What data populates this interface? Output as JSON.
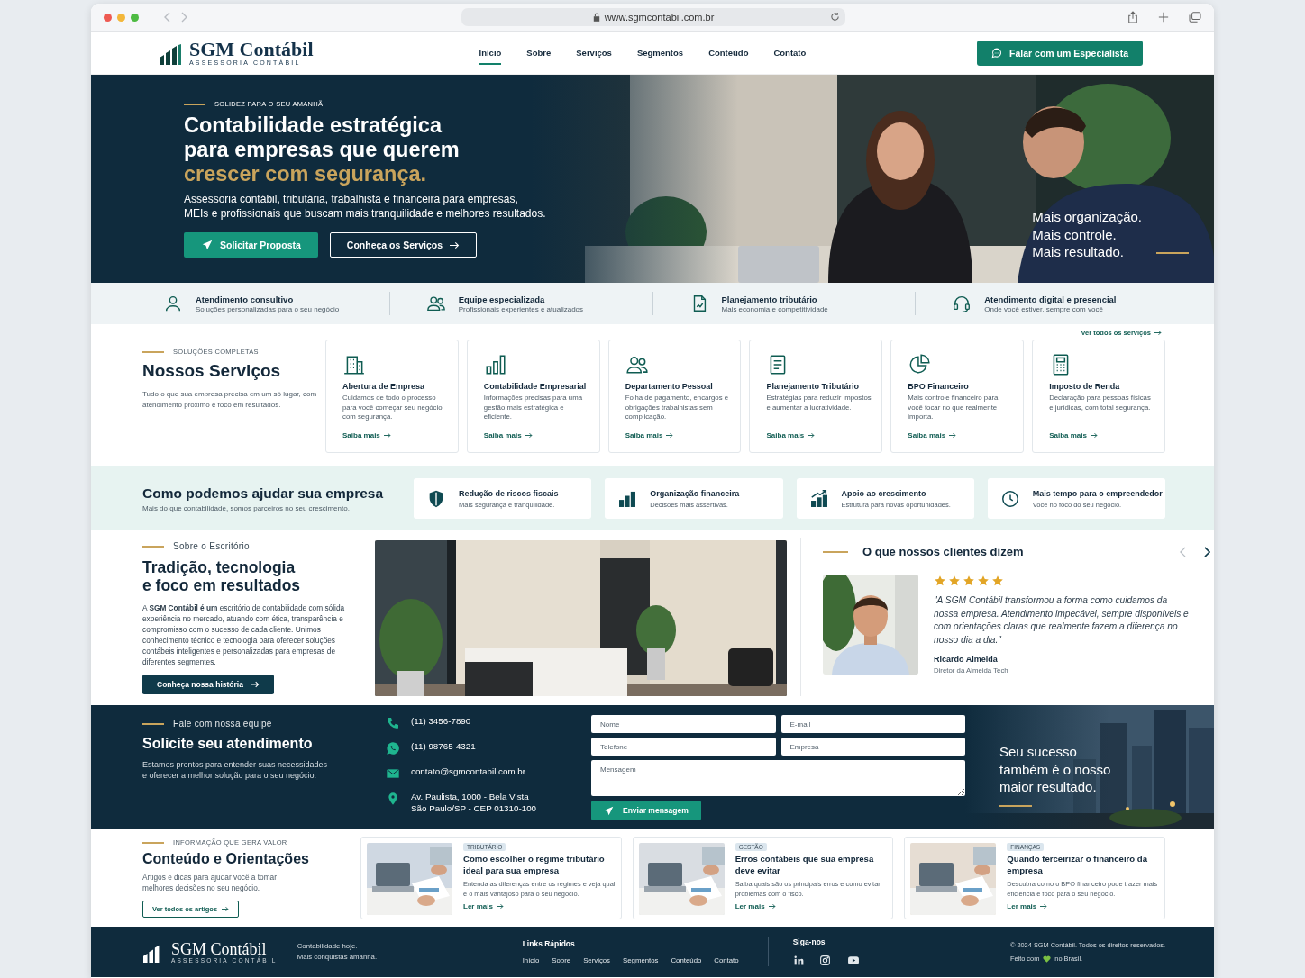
{
  "browser": {
    "url": "www.sgmcontabil.com.br"
  },
  "header": {
    "logo": {
      "name": "SGM Contábil",
      "tagline": "ASSESSORIA CONTÁBIL"
    },
    "nav": [
      {
        "label": "Início",
        "selected": true
      },
      {
        "label": "Sobre",
        "selected": false
      },
      {
        "label": "Serviços",
        "selected": false
      },
      {
        "label": "Segmentos",
        "selected": false
      },
      {
        "label": "Conteúdo",
        "selected": false
      },
      {
        "label": "Contato",
        "selected": false
      }
    ],
    "cta": "Falar com um Especialista"
  },
  "hero": {
    "eyebrow": "SOLIDEZ PARA O SEU AMANHÃ",
    "title": "Contabilidade estratégica\npara empresas que querem",
    "title_accent": "crescer com segurança.",
    "subtitle": "Assessoria contábil, tributária, trabalhista e financeira para empresas,\nMEIs e profissionais que buscam mais tranquilidade e melhores resultados.",
    "buttons": [
      {
        "label": "Solicitar Proposta",
        "kind": "primary"
      },
      {
        "label": "Conheça os Serviços",
        "kind": "outline"
      }
    ],
    "tagline": "Mais organização.\nMais controle.\nMais resultado."
  },
  "highlights": [
    {
      "kind": "user",
      "title": "Atendimento consultivo",
      "text": "Soluções personalizadas para o seu negócio"
    },
    {
      "kind": "users",
      "title": "Equipe especializada",
      "text": "Profissionais experientes e atualizados"
    },
    {
      "kind": "doc",
      "title": "Planejamento tributário",
      "text": "Mais economia e competitividade"
    },
    {
      "kind": "headset",
      "title": "Atendimento digital e presencial",
      "text": "Onde você estiver, sempre com você"
    }
  ],
  "services": {
    "eyebrow": "SOLUÇÕES COMPLETAS",
    "title": "Nossos Serviços",
    "text": "Tudo o que sua empresa precisa em um só lugar, com atendimento próximo e foco em resultados.",
    "see_all": "Ver todos os serviços",
    "items": [
      {
        "kind": "building",
        "title": "Abertura de Empresa",
        "text": "Cuidamos de todo o processo para você começar seu negócio com segurança.",
        "link": "Saiba mais"
      },
      {
        "kind": "bars",
        "title": "Contabilidade Empresarial",
        "text": "Informações precisas para uma gestão mais estratégica e eficiente.",
        "link": "Saiba mais"
      },
      {
        "kind": "users",
        "title": "Departamento Pessoal",
        "text": "Folha de pagamento, encargos e obrigações trabalhistas sem complicação.",
        "link": "Saiba mais"
      },
      {
        "kind": "clipboard",
        "title": "Planejamento Tributário",
        "text": "Estratégias para reduzir impostos e aumentar a lucratividade.",
        "link": "Saiba mais"
      },
      {
        "kind": "pie",
        "title": "BPO Financeiro",
        "text": "Mais controle financeiro para você focar no que realmente importa.",
        "link": "Saiba mais"
      },
      {
        "kind": "calculator",
        "title": "Imposto de Renda",
        "text": "Declaração para pessoas físicas e jurídicas, com total segurança.",
        "link": "Saiba mais"
      }
    ]
  },
  "help": {
    "title": "Como podemos ajudar sua empresa",
    "subtitle": "Mais do que contabilidade, somos parceiros no seu crescimento.",
    "items": [
      {
        "kind": "shield",
        "title": "Redução de riscos fiscais",
        "text": "Mais segurança e tranquilidade."
      },
      {
        "kind": "barsfill",
        "title": "Organização financeira",
        "text": "Decisões mais assertivas."
      },
      {
        "kind": "growth",
        "title": "Apoio ao crescimento",
        "text": "Estrutura para novas oportunidades."
      },
      {
        "kind": "clock",
        "title": "Mais tempo para o empreendedor",
        "text": "Você no foco do seu negócio."
      }
    ]
  },
  "about": {
    "eyebrow": "Sobre o Escritório",
    "title": "Tradição, tecnologia\ne foco em resultados",
    "text": "A **SGM Contábil é um** escritório de contabilidade com sólida experiência no mercado, atuando com ética, transparência e compromisso com o sucesso de cada cliente. Unimos conhecimento técnico e tecnologia para oferecer soluções contábeis inteligentes e personalizadas para empresas de diferentes segmentes.",
    "button": "Conheça nossa história"
  },
  "testimonials": {
    "title": "O que nossos clientes dizem",
    "prev_disabled": true,
    "stars": 5,
    "quote": "\"A SGM Contábil transformou a forma como cuidamos da nossa empresa. Atendimento impecável, sempre disponíveis e com orientações claras que realmente fazem a diferença no nosso dia a dia.\"",
    "name": "Ricardo Almeida",
    "role": "Diretor da Almeida Tech"
  },
  "contact": {
    "eyebrow": "Fale com nossa equipe",
    "title": "Solicite seu atendimento",
    "text": "Estamos prontos para entender suas necessidades\ne oferecer a melhor solução para o seu negócio.",
    "channels": [
      {
        "kind": "phone",
        "text": "(11) 3456-7890"
      },
      {
        "kind": "whatsapp",
        "text": "(11) 98765-4321"
      },
      {
        "kind": "mail",
        "text": "contato@sgmcontabil.com.br"
      },
      {
        "kind": "pin",
        "text": "Av. Paulista, 1000 - Bela Vista\nSão Paulo/SP - CEP 01310-100"
      }
    ],
    "fields": [
      {
        "placeholder": "Nome"
      },
      {
        "placeholder": "E-mail"
      },
      {
        "placeholder": "Telefone"
      },
      {
        "placeholder": "Empresa"
      }
    ],
    "message": {
      "placeholder": "Mensagem"
    },
    "submit": "Enviar mensagem",
    "slogan": "Seu sucesso\ntambém é o nosso\nmaior resultado."
  },
  "content": {
    "eyebrow": "INFORMAÇÃO QUE GERA VALOR",
    "title": "Conteúdo e Orientações",
    "text": "Artigos e dicas para ajudar você a tomar melhores decisões no seu negócio.",
    "button": "Ver todos os artigos",
    "articles": [
      {
        "tag": "TRIBUTÁRIO",
        "title": "Como escolher o regime tributário ideal para sua empresa",
        "text": "Entenda as diferenças entre os regimes e veja qual é o mais vantajoso para o seu negócio.",
        "link": "Ler mais"
      },
      {
        "tag": "GESTÃO",
        "title": "Erros contábeis que sua empresa deve evitar",
        "text": "Saiba quais são os principais erros e como evitar problemas com o fisco.",
        "link": "Ler mais"
      },
      {
        "tag": "FINANÇAS",
        "title": "Quando terceirizar o financeiro da empresa",
        "text": "Descubra como o BPO financeiro pode trazer mais eficiência e foco para o seu negócio.",
        "link": "Ler mais"
      }
    ]
  },
  "footer": {
    "logo": {
      "name": "SGM Contábil",
      "tagline": "ASSESSORIA CONTÁBIL"
    },
    "slogan": "Contabilidade hoje.\nMais conquistas amanhã.",
    "links_title": "Links Rápidos",
    "links": [
      "Início",
      "Sobre",
      "Serviços",
      "Segmentos",
      "Conteúdo",
      "Contato"
    ],
    "social_title": "Siga-nos",
    "social": [
      {
        "kind": "linkedin"
      },
      {
        "kind": "instagram"
      },
      {
        "kind": "youtube"
      }
    ],
    "copyright": "© 2024 SGM Contábil. Todos os direitos reservados.",
    "made_before": "Feito com",
    "made_after": "no Brasil."
  }
}
